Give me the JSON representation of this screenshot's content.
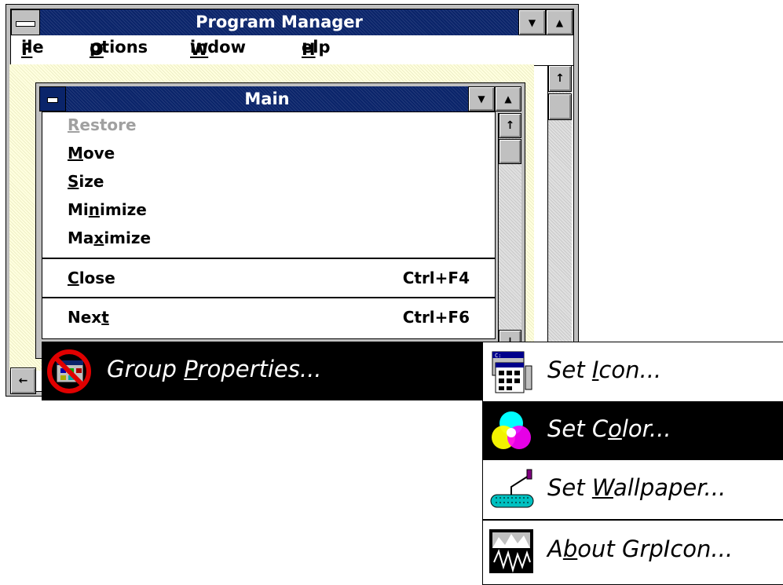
{
  "program_manager": {
    "title": "Program Manager",
    "menubar": [
      {
        "label": "File",
        "hotkey": "F"
      },
      {
        "label": "Options",
        "hotkey": "O"
      },
      {
        "label": "Window",
        "hotkey": "W"
      },
      {
        "label": "Help",
        "hotkey": "H"
      }
    ]
  },
  "main_window": {
    "title": "Main"
  },
  "system_menu": {
    "items": [
      {
        "pre": "",
        "key": "R",
        "post": "estore",
        "shortcut": "",
        "disabled": true
      },
      {
        "pre": "",
        "key": "M",
        "post": "ove",
        "shortcut": ""
      },
      {
        "pre": "",
        "key": "S",
        "post": "ize",
        "shortcut": ""
      },
      {
        "pre": "Mi",
        "key": "n",
        "post": "imize",
        "shortcut": ""
      },
      {
        "pre": "Ma",
        "key": "x",
        "post": "imize",
        "shortcut": ""
      },
      {
        "pre": "",
        "key": "C",
        "post": "lose",
        "shortcut": "Ctrl+F4"
      },
      {
        "pre": "Nex",
        "key": "t",
        "post": "",
        "shortcut": "Ctrl+F6"
      }
    ]
  },
  "group_properties": {
    "pre": "Group ",
    "key": "P",
    "post": "roperties..."
  },
  "submenu": {
    "items": [
      {
        "pre": "Set ",
        "key": "I",
        "post": "con...",
        "icon": "program-group-icon",
        "highlighted": false
      },
      {
        "pre": "Set C",
        "key": "o",
        "post": "lor...",
        "icon": "color-circles-icon",
        "highlighted": true
      },
      {
        "pre": "Set ",
        "key": "W",
        "post": "allpaper...",
        "icon": "paint-roller-icon",
        "highlighted": false
      },
      {
        "pre": "A",
        "key": "b",
        "post": "out GrpIcon...",
        "icon": "grpicon-logo-icon",
        "highlighted": false
      }
    ]
  }
}
